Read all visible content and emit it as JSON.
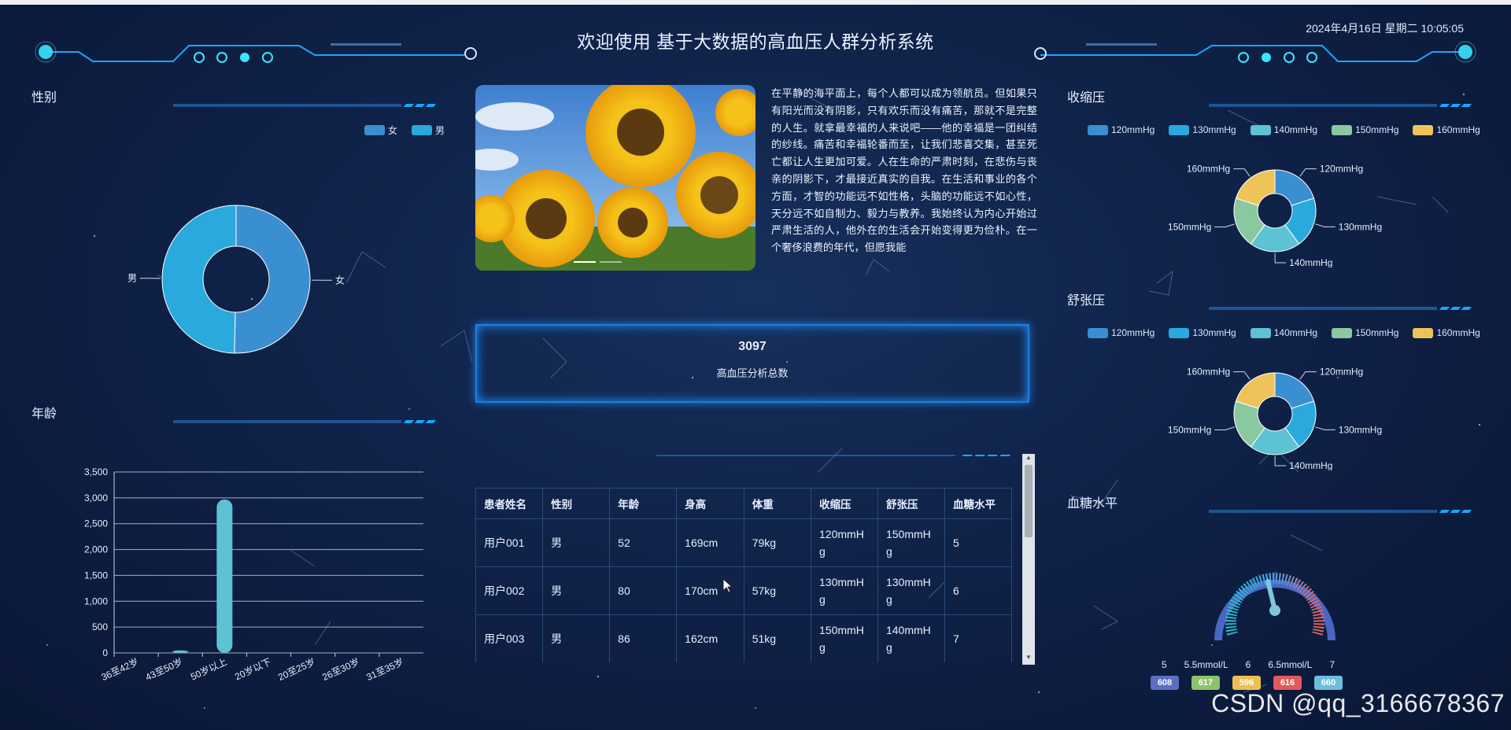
{
  "header": {
    "title": "欢迎使用 基于大数据的高血压人群分析系统",
    "datetime": "2024年4月16日 星期二 10:05:05"
  },
  "gender": {
    "title": "性别",
    "legend": [
      "女",
      "男"
    ],
    "colors": [
      "#3a8fd0",
      "#2aa9dc"
    ],
    "slice_labels": [
      "女",
      "男"
    ],
    "chart_data": {
      "type": "pie",
      "categories": [
        "女",
        "男"
      ],
      "values": [
        1560,
        1537
      ],
      "donut": true
    }
  },
  "age": {
    "title": "年龄",
    "chart_data": {
      "type": "bar",
      "categories": [
        "36至42岁",
        "43至50岁",
        "50岁以上",
        "20岁以下",
        "20至25岁",
        "26至30岁",
        "31至35岁"
      ],
      "values": [
        0,
        50,
        2970,
        0,
        0,
        0,
        0
      ],
      "yticks": [
        "0",
        "500",
        "1,000",
        "1,500",
        "2,000",
        "2,500",
        "3,000",
        "3,500"
      ],
      "ylim": [
        0,
        3500
      ],
      "grid": true
    }
  },
  "intro": {
    "text": "在平静的海平面上，每个人都可以成为领航员。但如果只有阳光而没有阴影，只有欢乐而没有痛苦，那就不是完整的人生。就拿最幸福的人来说吧——他的幸福是一团纠结的纱线。痛苦和幸福轮番而至，让我们悲喜交集，甚至死亡都让人生更加可爱。人在生命的严肃时刻，在悲伤与丧亲的阴影下，才最接近真实的自我。在生活和事业的各个方面，才智的功能远不如性格，头脑的功能远不如心性，天分远不如自制力、毅力与教养。我始终认为内心开始过严肃生活的人，他外在的生活会开始变得更为俭朴。在一个奢侈浪费的年代，但愿我能"
  },
  "stat": {
    "number": "3097",
    "label": "高血压分析总数"
  },
  "table": {
    "headers": [
      "患者姓名",
      "性别",
      "年龄",
      "身高",
      "体重",
      "收缩压",
      "舒张压",
      "血糖水平"
    ],
    "rows": [
      [
        "用户001",
        "男",
        "52",
        "169cm",
        "79kg",
        "120mmHg",
        "150mmHg",
        "5"
      ],
      [
        "用户002",
        "男",
        "80",
        "170cm",
        "57kg",
        "130mmHg",
        "130mmHg",
        "6"
      ],
      [
        "用户003",
        "男",
        "86",
        "162cm",
        "51kg",
        "150mmHg",
        "140mmHg",
        "7"
      ]
    ]
  },
  "systolic": {
    "title": "收缩压",
    "legend": [
      "120mmHg",
      "130mmHg",
      "140mmHg",
      "150mmHg",
      "160mmHg"
    ],
    "colors": [
      "#3a8fd0",
      "#2aa9dc",
      "#5cc2d4",
      "#8ac9a0",
      "#eec35a"
    ],
    "chart_data": {
      "type": "pie",
      "categories": [
        "120mmHg",
        "130mmHg",
        "140mmHg",
        "150mmHg",
        "160mmHg"
      ],
      "values": [
        620,
        618,
        619,
        620,
        620
      ],
      "donut": true
    }
  },
  "diastolic": {
    "title": "舒张压",
    "legend": [
      "120mmHg",
      "130mmHg",
      "140mmHg",
      "150mmHg",
      "160mmHg"
    ],
    "colors": [
      "#3a8fd0",
      "#2aa9dc",
      "#5cc2d4",
      "#8ac9a0",
      "#eec35a"
    ],
    "chart_data": {
      "type": "pie",
      "categories": [
        "120mmHg",
        "130mmHg",
        "140mmHg",
        "150mmHg",
        "160mmHg"
      ],
      "values": [
        620,
        618,
        619,
        620,
        620
      ],
      "donut": true
    }
  },
  "glucose": {
    "title": "血糖水平",
    "scale_labels": [
      "5",
      "5.5mmol/L",
      "6",
      "6.5mmol/L",
      "7"
    ],
    "badges": [
      "608",
      "617",
      "596",
      "616",
      "660"
    ],
    "badge_colors": [
      "#5a6fc2",
      "#8cc46a",
      "#eebf4f",
      "#e05a5a",
      "#6bbfdc"
    ],
    "value": 5.9
  },
  "watermark": "CSDN @qq_3166678367"
}
